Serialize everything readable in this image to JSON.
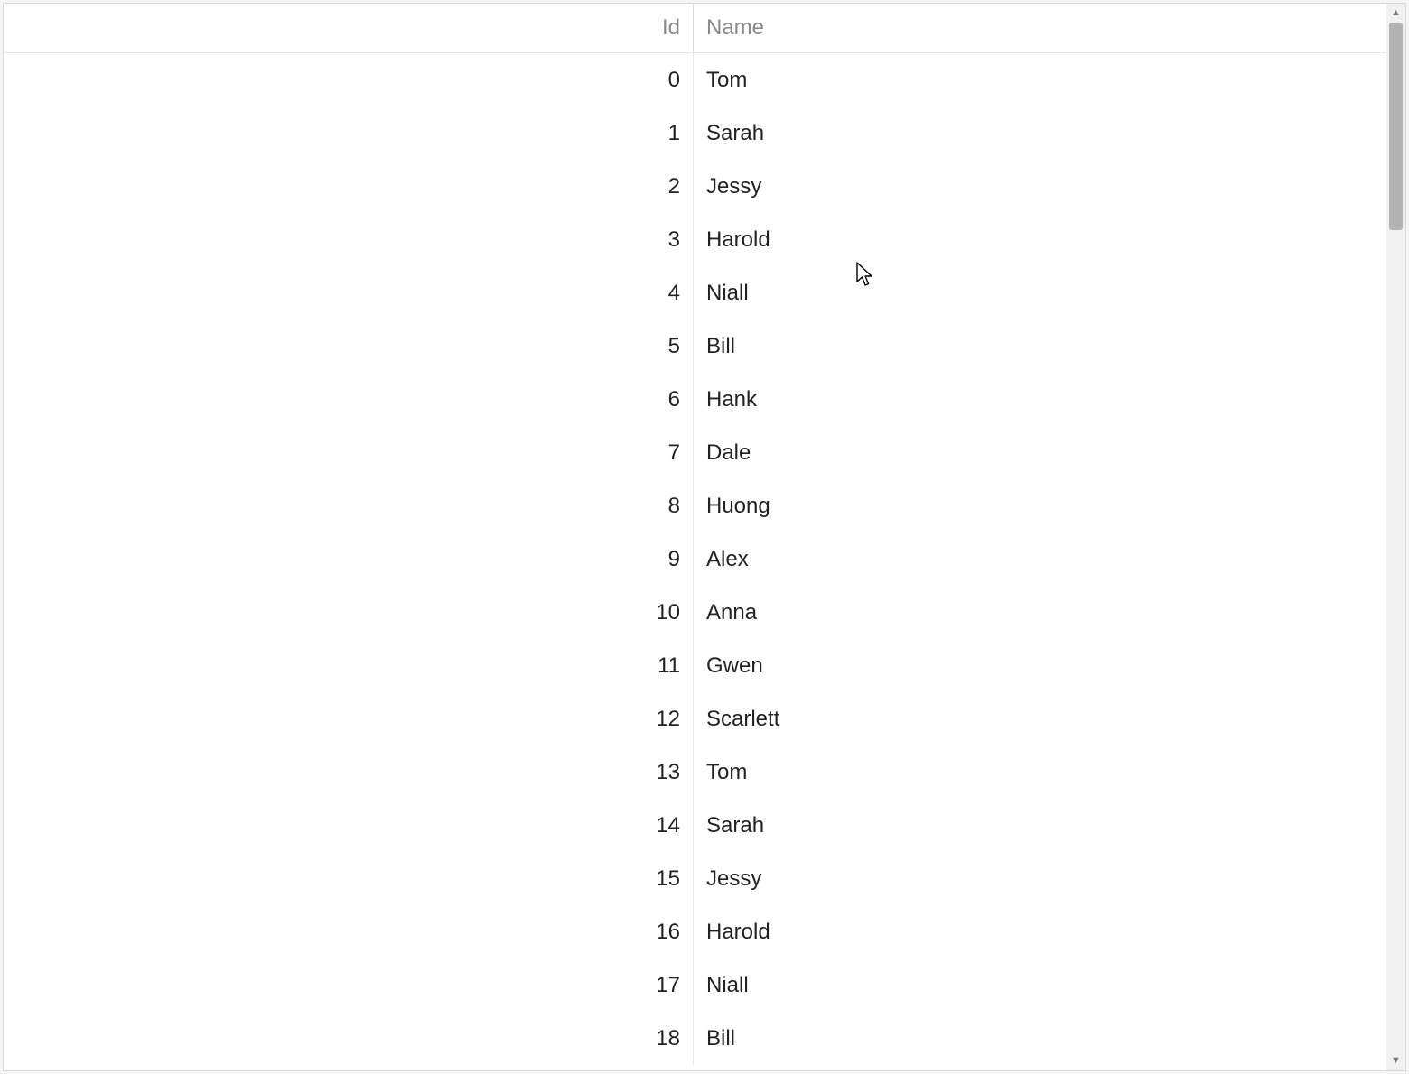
{
  "grid": {
    "columns": {
      "id": "Id",
      "name": "Name"
    },
    "rows": [
      {
        "id": "0",
        "name": "Tom"
      },
      {
        "id": "1",
        "name": "Sarah"
      },
      {
        "id": "2",
        "name": "Jessy"
      },
      {
        "id": "3",
        "name": "Harold"
      },
      {
        "id": "4",
        "name": "Niall"
      },
      {
        "id": "5",
        "name": "Bill"
      },
      {
        "id": "6",
        "name": "Hank"
      },
      {
        "id": "7",
        "name": "Dale"
      },
      {
        "id": "8",
        "name": "Huong"
      },
      {
        "id": "9",
        "name": "Alex"
      },
      {
        "id": "10",
        "name": "Anna"
      },
      {
        "id": "11",
        "name": "Gwen"
      },
      {
        "id": "12",
        "name": "Scarlett"
      },
      {
        "id": "13",
        "name": "Tom"
      },
      {
        "id": "14",
        "name": "Sarah"
      },
      {
        "id": "15",
        "name": "Jessy"
      },
      {
        "id": "16",
        "name": "Harold"
      },
      {
        "id": "17",
        "name": "Niall"
      },
      {
        "id": "18",
        "name": "Bill"
      }
    ]
  }
}
